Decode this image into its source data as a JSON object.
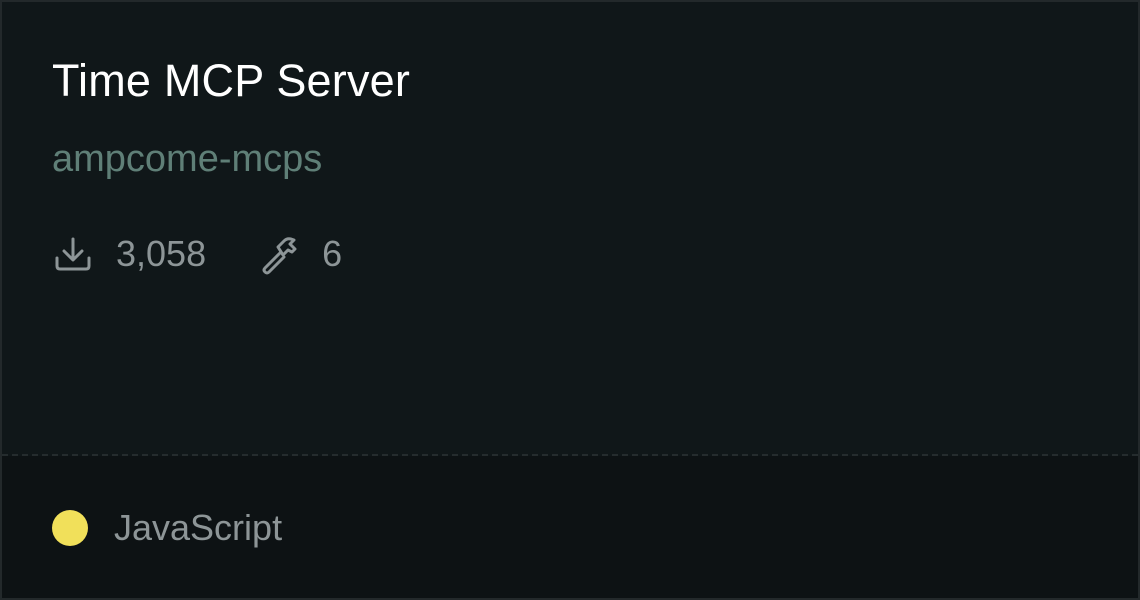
{
  "card": {
    "title": "Time MCP Server",
    "owner": "ampcome-mcps",
    "stats": {
      "downloads": {
        "icon": "download-icon",
        "value": "3,058"
      },
      "tools": {
        "icon": "hammer-icon",
        "value": "6"
      }
    },
    "language": {
      "label": "JavaScript",
      "color": "#f1e05a"
    }
  }
}
